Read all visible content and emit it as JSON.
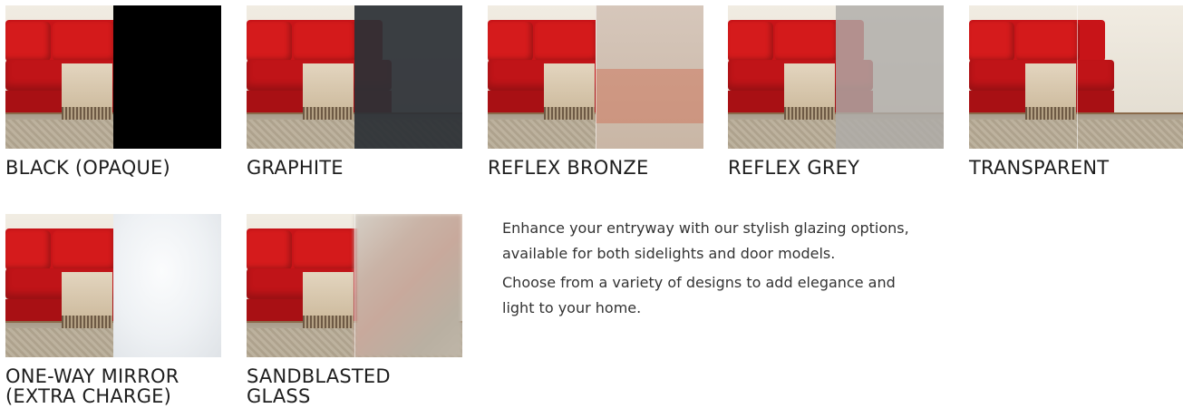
{
  "options": [
    {
      "label": "BLACK (OPAQUE)",
      "glass": "black"
    },
    {
      "label": "GRAPHITE",
      "glass": "graphite"
    },
    {
      "label": "REFLEX BRONZE",
      "glass": "bronze"
    },
    {
      "label": "REFLEX GREY",
      "glass": "grey"
    },
    {
      "label": "TRANSPARENT",
      "glass": "transparent"
    },
    {
      "label_line1": "ONE-WAY MIRROR",
      "label_line2": "(EXTRA CHARGE)",
      "glass": "mirror"
    },
    {
      "label_line1": "SANDBLASTED",
      "label_line2": "GLASS",
      "glass": "sandblasted"
    }
  ],
  "description": {
    "line1": "Enhance your entryway with our stylish glazing options,",
    "line2": "available for both sidelights and door models.",
    "line3": "Choose from a variety of designs to add elegance and",
    "line4": "light to your home."
  },
  "colors": {
    "sofa_red": "#c81418",
    "text": "#1e1e1e"
  }
}
